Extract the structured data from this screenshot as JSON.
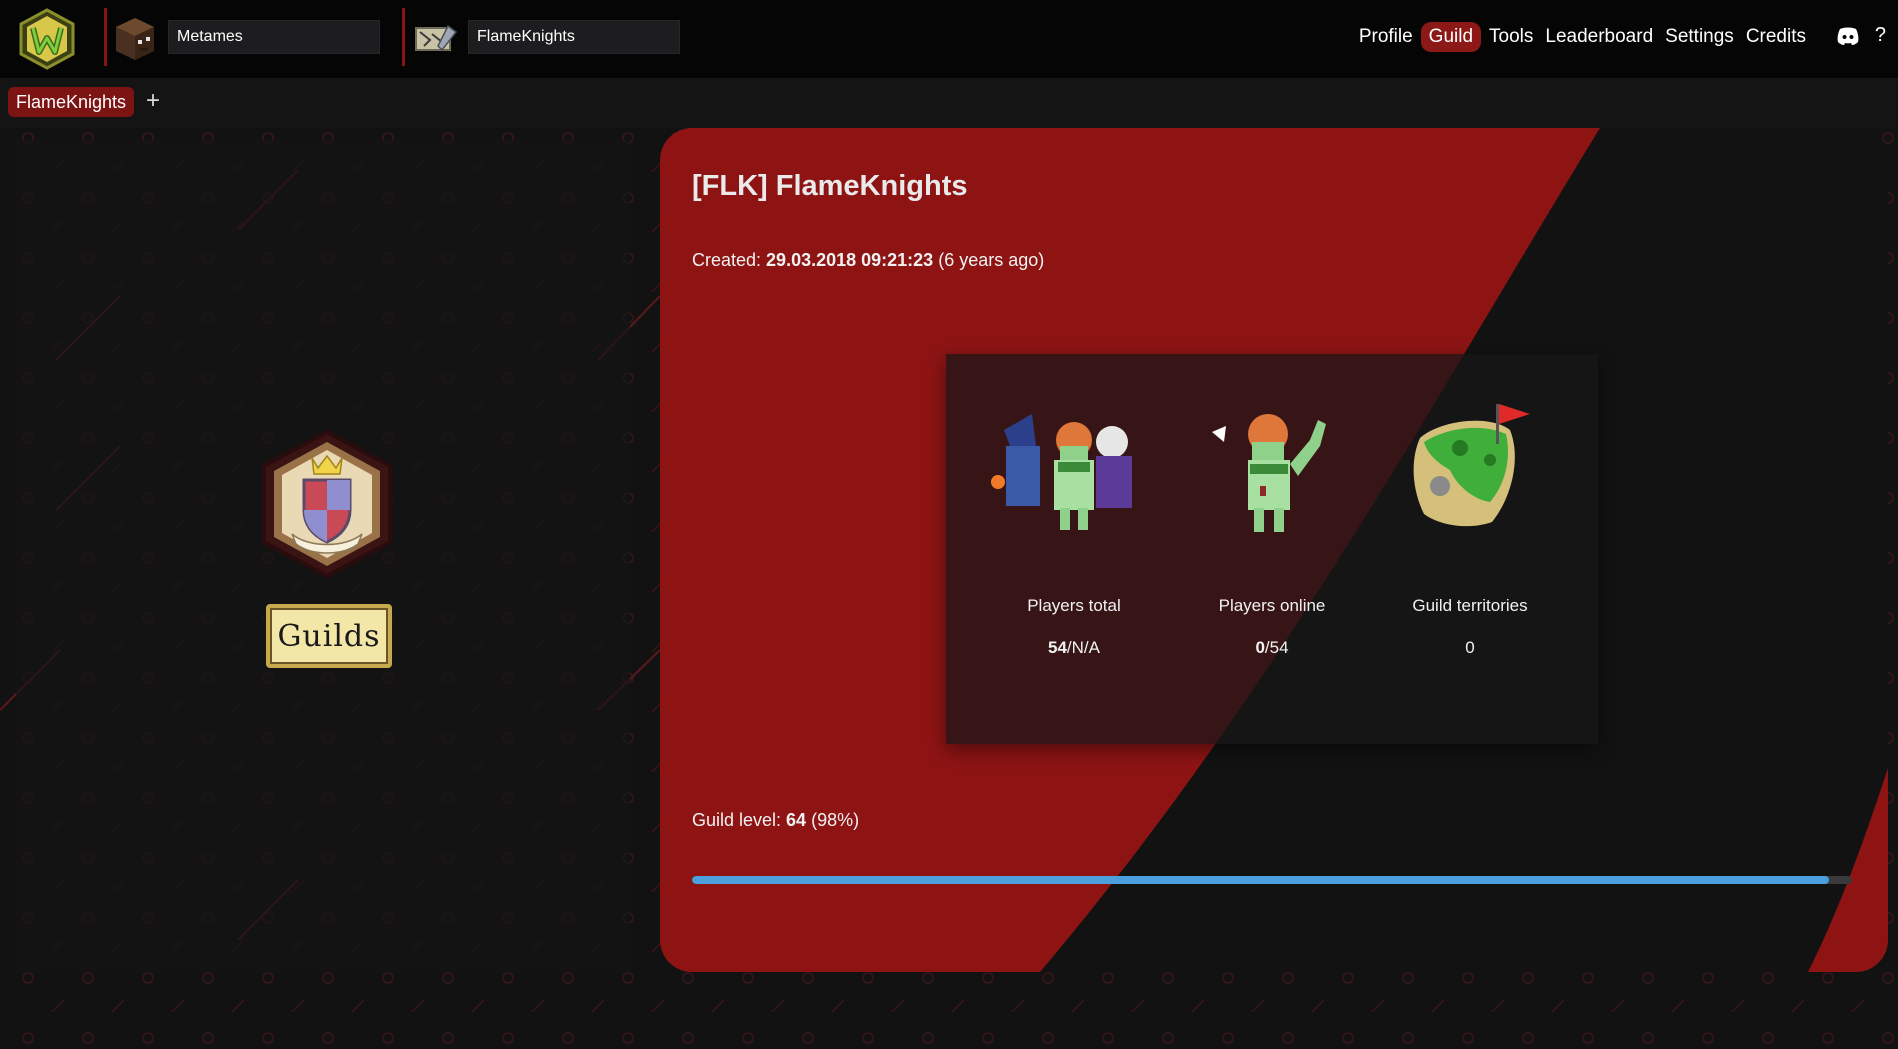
{
  "header": {
    "player_search_value": "Metames",
    "guild_search_value": "FlameKnights",
    "nav": [
      {
        "label": "Profile",
        "active": false
      },
      {
        "label": "Guild",
        "active": true
      },
      {
        "label": "Tools",
        "active": false
      },
      {
        "label": "Leaderboard",
        "active": false
      },
      {
        "label": "Settings",
        "active": false
      },
      {
        "label": "Credits",
        "active": false
      }
    ],
    "help_label": "?"
  },
  "tabs": {
    "items": [
      {
        "label": "FlameKnights"
      }
    ],
    "add_label": "+"
  },
  "left_panel": {
    "sign_label": "Guilds"
  },
  "guild": {
    "title": "[FLK] FlameKnights",
    "created_label": "Created: ",
    "created_date": "29.03.2018 09:21:23",
    "created_ago": " (6 years ago)",
    "stats": [
      {
        "label": "Players total",
        "value_bold": "54",
        "value_rest": "/N/A",
        "icon": "adventurers-group-icon"
      },
      {
        "label": "Players online",
        "value_bold": "0",
        "value_rest": "/54",
        "icon": "waving-adventurer-icon"
      },
      {
        "label": "Guild territories",
        "value_bold": "",
        "value_rest": "0",
        "icon": "territory-map-flag-icon"
      }
    ],
    "level_label": "Guild level: ",
    "level_value": "64",
    "level_percent_text": " (98%)",
    "level_progress": 0.98
  },
  "colors": {
    "accent_red": "#8d1818",
    "card_red": "#8e1414",
    "progress_blue": "#4a9fdc",
    "background": "#121213"
  }
}
